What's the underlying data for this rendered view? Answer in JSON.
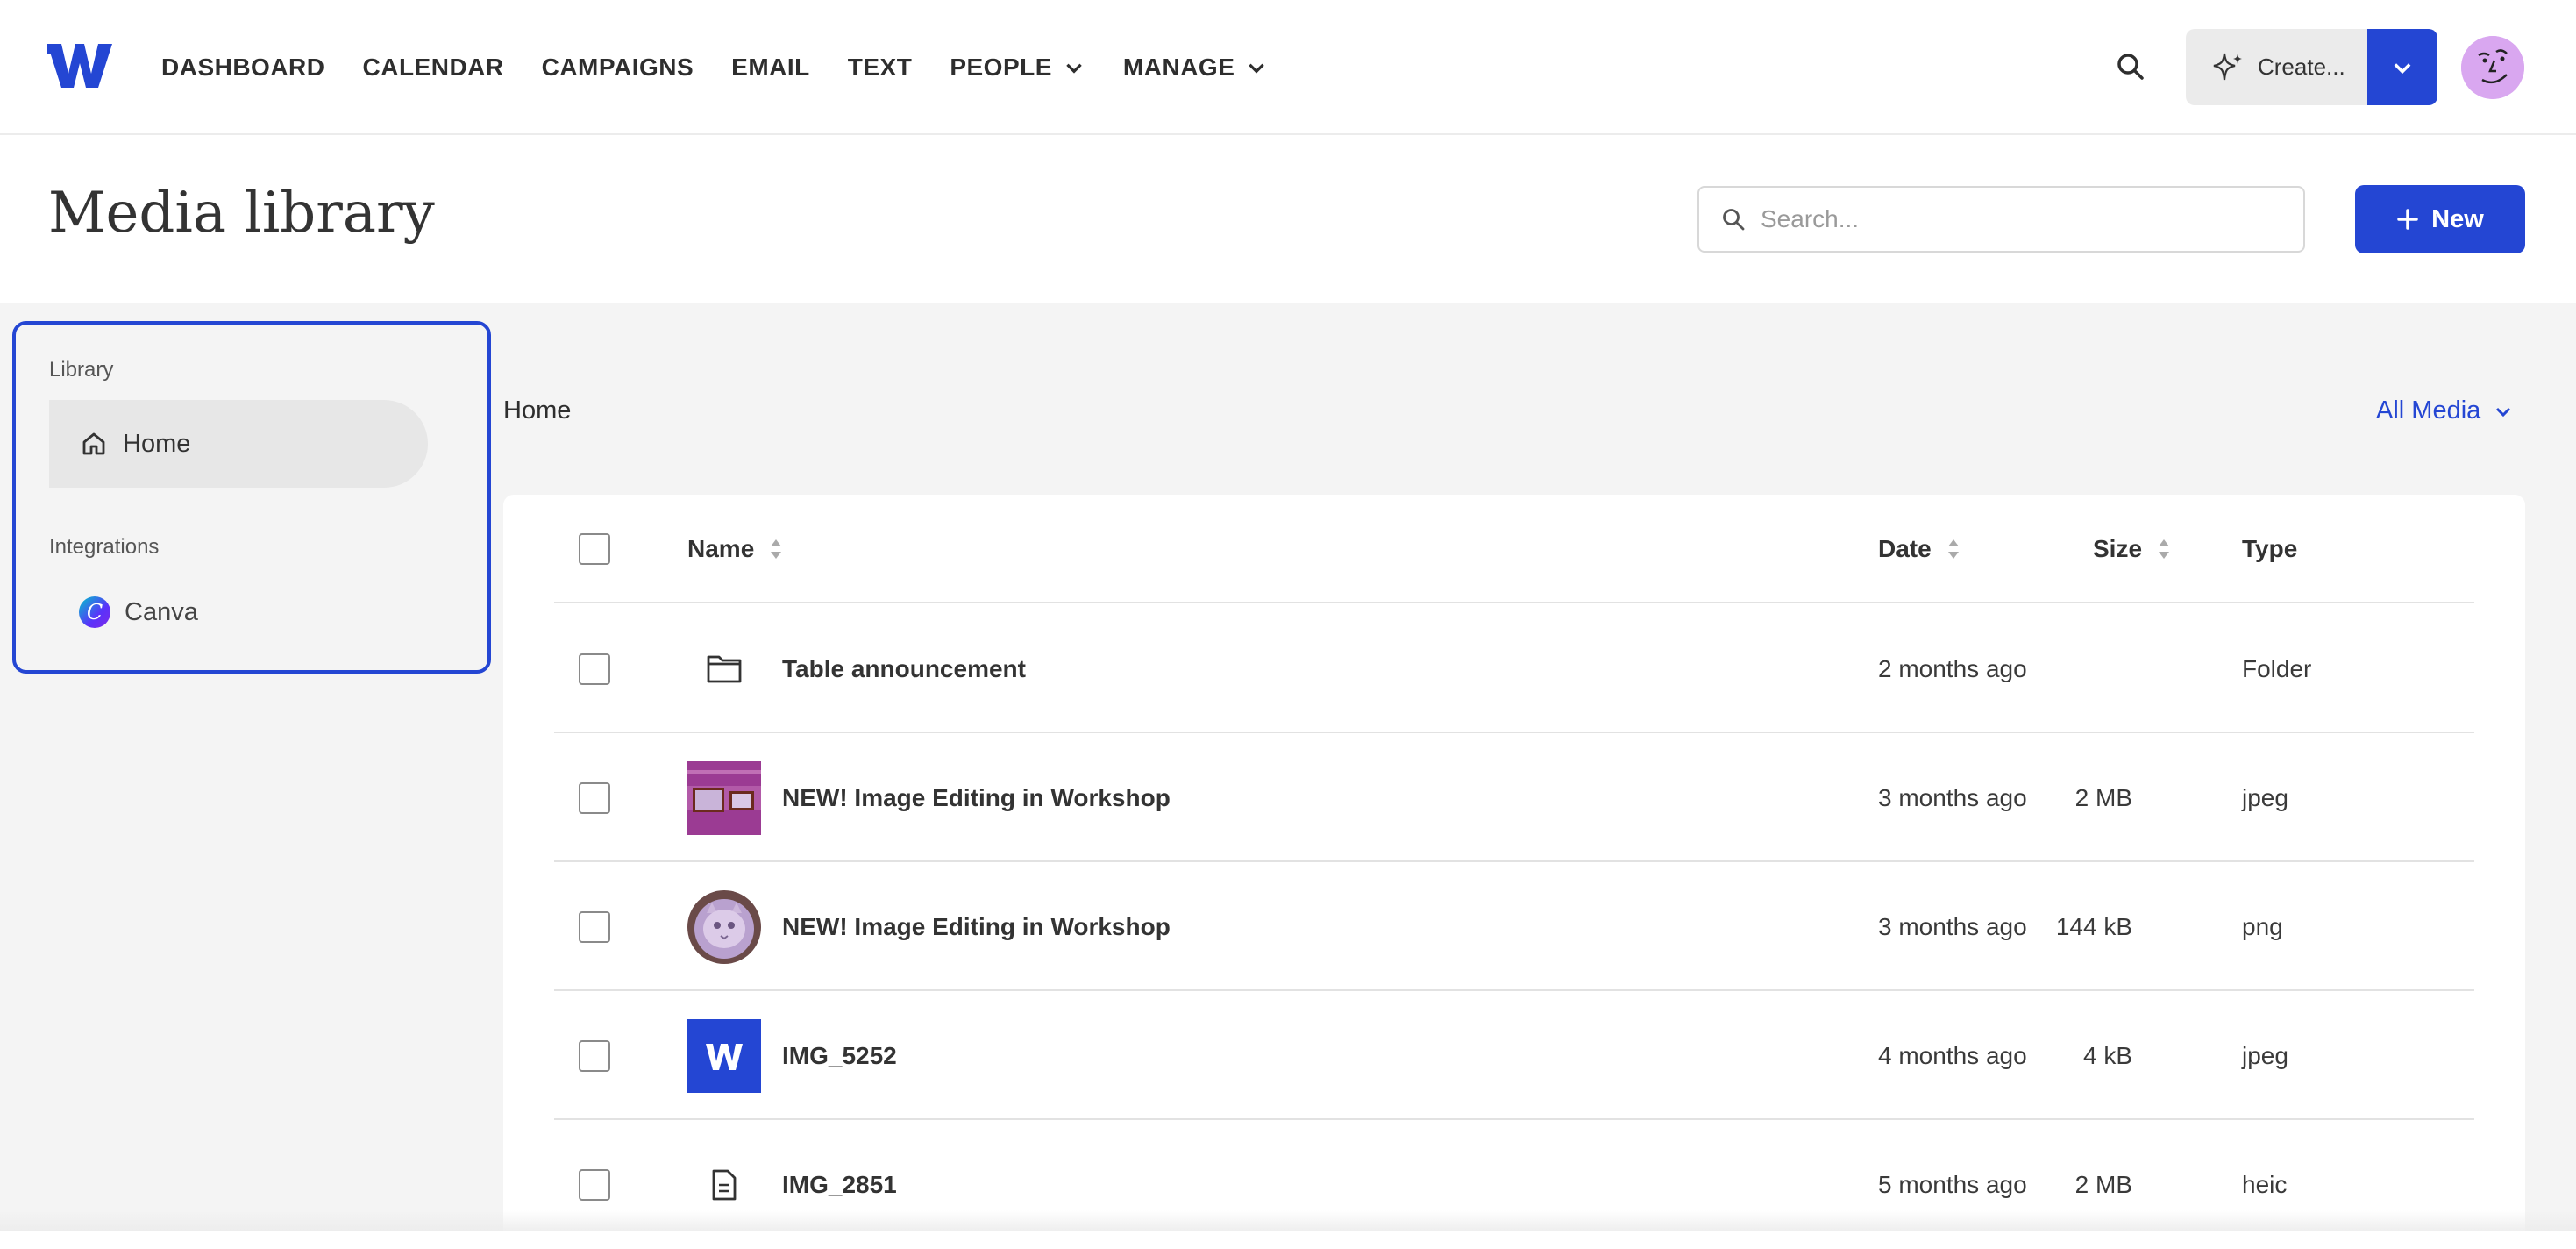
{
  "nav": {
    "items": [
      {
        "label": "DASHBOARD",
        "has_dropdown": false
      },
      {
        "label": "CALENDAR",
        "has_dropdown": false
      },
      {
        "label": "CAMPAIGNS",
        "has_dropdown": false
      },
      {
        "label": "EMAIL",
        "has_dropdown": false
      },
      {
        "label": "TEXT",
        "has_dropdown": false
      },
      {
        "label": "PEOPLE",
        "has_dropdown": true
      },
      {
        "label": "MANAGE",
        "has_dropdown": true
      }
    ],
    "create_label": "Create...",
    "brand_color": "#2446d3"
  },
  "page": {
    "title": "Media library",
    "search_placeholder": "Search...",
    "new_label": "New"
  },
  "sidebar": {
    "library_heading": "Library",
    "home_label": "Home",
    "integrations_heading": "Integrations",
    "canva_label": "Canva",
    "canva_glyph": "C"
  },
  "breadcrumb": "Home",
  "filter": {
    "selected": "All Media"
  },
  "table": {
    "columns": {
      "name": "Name",
      "date": "Date",
      "size": "Size",
      "type": "Type"
    },
    "rows": [
      {
        "name": "Table announcement",
        "date": "2 months ago",
        "size": "",
        "type": "Folder",
        "thumb": "folder-icon"
      },
      {
        "name": "NEW! Image Editing in Workshop",
        "date": "3 months ago",
        "size": "2 MB",
        "type": "jpeg",
        "thumb": "purple-cat-banner"
      },
      {
        "name": "NEW! Image Editing in Workshop",
        "date": "3 months ago",
        "size": "144 kB",
        "type": "png",
        "thumb": "round-cat-avatar"
      },
      {
        "name": "IMG_5252",
        "date": "4 months ago",
        "size": "4 kB",
        "type": "jpeg",
        "thumb": "w-logo-tile"
      },
      {
        "name": "IMG_2851",
        "date": "5 months ago",
        "size": "2 MB",
        "type": "heic",
        "thumb": "document-icon"
      }
    ]
  }
}
